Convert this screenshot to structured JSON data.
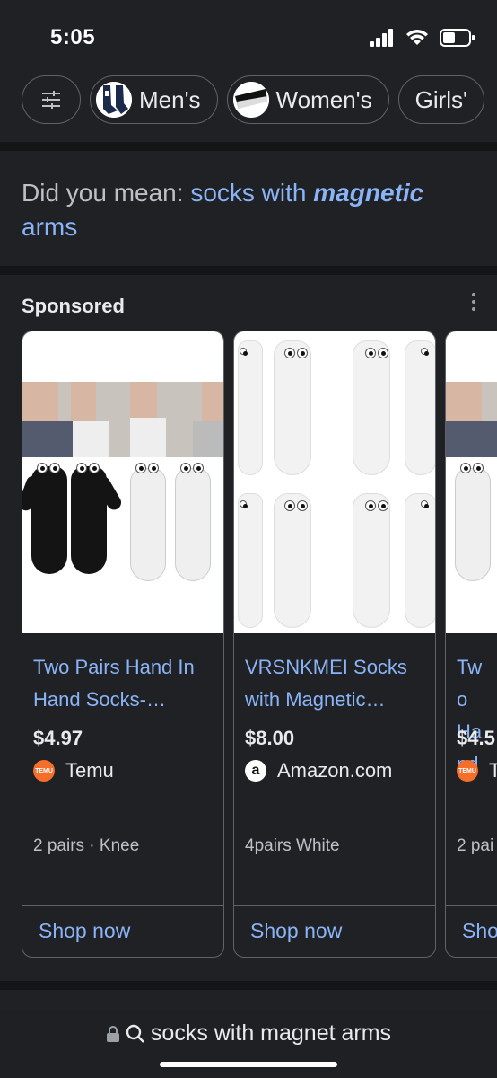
{
  "status": {
    "time": "5:05"
  },
  "chips": [
    {
      "label": "Men's",
      "icon": "mens-sock-thumb"
    },
    {
      "label": "Women's",
      "icon": "womens-sock-thumb"
    },
    {
      "label": "Girls'"
    }
  ],
  "did_you_mean": {
    "prefix": "Did you mean: ",
    "suggestion_part1": "socks with ",
    "suggestion_bold": "magnetic",
    "suggestion_part2": "arms"
  },
  "sponsored": {
    "label": "Sponsored",
    "cards": [
      {
        "title": "Two Pairs Hand In Hand Socks-…",
        "price": "$4.97",
        "store": "Temu",
        "store_icon_text": "TEMU",
        "store_color": "#f56e2a",
        "attr": "2 pairs · Knee",
        "cta": "Shop now"
      },
      {
        "title": "VRSNKMEI Socks with Magnetic…",
        "price": "$8.00",
        "store": "Amazon.com",
        "store_icon_text": "a",
        "store_color": "#ffffff",
        "attr": "4pairs White",
        "cta": "Shop now"
      },
      {
        "title": "Two Hand",
        "price": "$4.5",
        "store": "T",
        "store_icon_text": "TEMU",
        "store_color": "#f56e2a",
        "attr": "2 pai",
        "cta": "Sho"
      }
    ]
  },
  "url_bar": {
    "query": "socks with magnet arms"
  },
  "colors": {
    "link": "#8ab4f8",
    "background": "#202124"
  }
}
